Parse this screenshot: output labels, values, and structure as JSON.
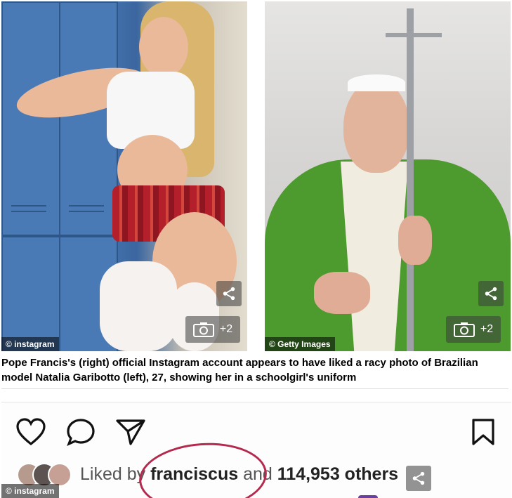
{
  "photos": {
    "left": {
      "credit": "© instagram",
      "gallery_count": "+2"
    },
    "right": {
      "credit": "© Getty Images",
      "gallery_count": "+2"
    }
  },
  "caption": "Pope Francis's (right) official Instagram account appears to have liked a racy photo of Brazilian model Natalia Garibotto (left), 27, showing her in a schoolgirl's uniform",
  "instagram": {
    "liked_prefix": "Liked by ",
    "liked_user": "franciscus",
    "liked_middle": " and ",
    "liked_count": "114,953 others",
    "credit": "© instagram"
  },
  "icons": {
    "share": "share-icon",
    "camera": "camera-icon",
    "heart": "heart-icon",
    "comment": "comment-icon",
    "send": "send-icon",
    "bookmark": "bookmark-icon"
  },
  "colors": {
    "accent_circle": "#b5294e",
    "vestment_green": "#4d9a2f",
    "locker_blue": "#4a7ab5"
  }
}
